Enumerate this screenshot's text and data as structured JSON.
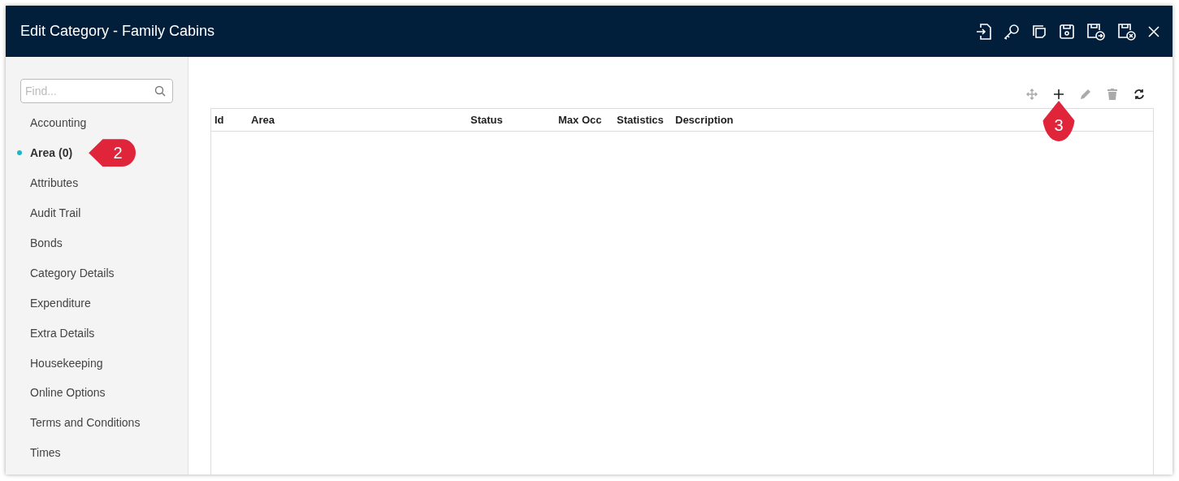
{
  "window": {
    "title": "Edit Category - Family Cabins"
  },
  "sidebar": {
    "search": {
      "placeholder": "Find..."
    },
    "items": [
      {
        "label": "Accounting",
        "selected": false
      },
      {
        "label": "Area (0)",
        "selected": true
      },
      {
        "label": "Attributes",
        "selected": false
      },
      {
        "label": "Audit Trail",
        "selected": false
      },
      {
        "label": "Bonds",
        "selected": false
      },
      {
        "label": "Category Details",
        "selected": false
      },
      {
        "label": "Expenditure",
        "selected": false
      },
      {
        "label": "Extra Details",
        "selected": false
      },
      {
        "label": "Housekeeping",
        "selected": false
      },
      {
        "label": "Online Options",
        "selected": false
      },
      {
        "label": "Terms and Conditions",
        "selected": false
      },
      {
        "label": "Times",
        "selected": false
      }
    ]
  },
  "table": {
    "columns": [
      "Id",
      "Area",
      "Status",
      "Max Occ",
      "Statistics",
      "Description"
    ]
  },
  "callouts": [
    {
      "label": "2"
    },
    {
      "label": "3"
    }
  ]
}
